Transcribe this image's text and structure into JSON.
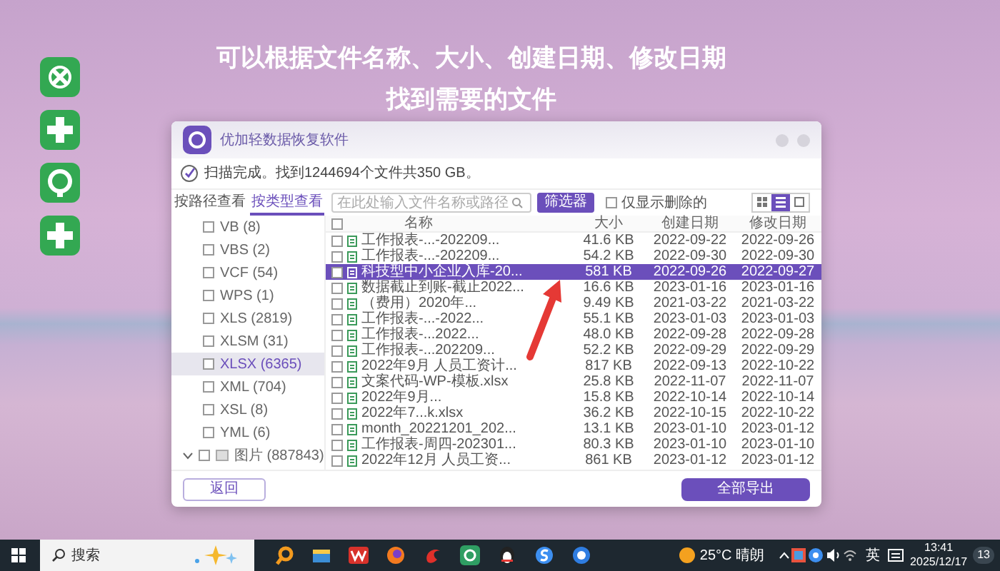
{
  "heading": {
    "lines": [
      "可以根据文件名称、大小、创建日期、修改日期",
      "找到需要的文件"
    ]
  },
  "app": {
    "title": "优加轻数据恢复软件",
    "scan_status": "扫描完成。找到1244694个文件共350 GB。",
    "view_tabs": [
      {
        "label": "按路径查看",
        "selected": false
      },
      {
        "label": "按类型查看",
        "selected": true
      }
    ],
    "search": {
      "placeholder": "在此处输入文件名称或路径"
    },
    "filter_button": "筛选器",
    "deleted_only": {
      "label": "仅显示删除的",
      "checked": false
    },
    "view_modes": [
      {
        "kind": "grid",
        "selected": false
      },
      {
        "kind": "list",
        "selected": true
      },
      {
        "kind": "preview",
        "selected": false
      }
    ],
    "file_types": [
      {
        "kind": "type",
        "label": "VB (8)",
        "checked": false,
        "selected": false
      },
      {
        "kind": "type",
        "label": "VBS (2)",
        "checked": false,
        "selected": false
      },
      {
        "kind": "type",
        "label": "VCF (54)",
        "checked": false,
        "selected": false
      },
      {
        "kind": "type",
        "label": "WPS (1)",
        "checked": false,
        "selected": false
      },
      {
        "kind": "type",
        "label": "XLS (2819)",
        "checked": false,
        "selected": false
      },
      {
        "kind": "type",
        "label": "XLSM (31)",
        "checked": false,
        "selected": false
      },
      {
        "kind": "type",
        "label": "XLSX (6365)",
        "checked": false,
        "selected": true
      },
      {
        "kind": "type",
        "label": "XML (704)",
        "checked": false,
        "selected": false
      },
      {
        "kind": "type",
        "label": "XSL (8)",
        "checked": false,
        "selected": false
      },
      {
        "kind": "type",
        "label": "YML (6)",
        "checked": false,
        "selected": false
      },
      {
        "kind": "group",
        "label": "图片 (887843)",
        "checked": false,
        "selected": false,
        "expanded": true
      }
    ],
    "table": {
      "columns": [
        "名称",
        "大小",
        "创建日期",
        "修改日期"
      ],
      "select_all": false,
      "rows": [
        {
          "name": "工作报表-...-202209...",
          "size": "41.6 KB",
          "created": "2022-09-22",
          "modified": "2022-09-26",
          "checked": false,
          "selected": false
        },
        {
          "name": "工作报表-...-202209...",
          "size": "54.2 KB",
          "created": "2022-09-30",
          "modified": "2022-09-30",
          "checked": false,
          "selected": false
        },
        {
          "name": "科技型中小企业入库-20...",
          "size": "581 KB",
          "created": "2022-09-26",
          "modified": "2022-09-27",
          "checked": false,
          "selected": true
        },
        {
          "name": "数据截止到账-截止2022...",
          "size": "16.6 KB",
          "created": "2023-01-16",
          "modified": "2023-01-16",
          "checked": false,
          "selected": false
        },
        {
          "name": "（费用）2020年...",
          "size": "9.49 KB",
          "created": "2021-03-22",
          "modified": "2021-03-22",
          "checked": false,
          "selected": false
        },
        {
          "name": "工作报表-...-2022...",
          "size": "55.1 KB",
          "created": "2023-01-03",
          "modified": "2023-01-03",
          "checked": false,
          "selected": false
        },
        {
          "name": "工作报表-...2022...",
          "size": "48.0 KB",
          "created": "2022-09-28",
          "modified": "2022-09-28",
          "checked": false,
          "selected": false
        },
        {
          "name": "工作报表-...202209...",
          "size": "52.2 KB",
          "created": "2022-09-29",
          "modified": "2022-09-29",
          "checked": false,
          "selected": false
        },
        {
          "name": "2022年9月 人员工资计...",
          "size": "817 KB",
          "created": "2022-09-13",
          "modified": "2022-10-22",
          "checked": false,
          "selected": false
        },
        {
          "name": "文案代码-WP-模板.xlsx",
          "size": "25.8 KB",
          "created": "2022-11-07",
          "modified": "2022-11-07",
          "checked": false,
          "selected": false
        },
        {
          "name": "2022年9月...",
          "size": "15.8 KB",
          "created": "2022-10-14",
          "modified": "2022-10-14",
          "checked": false,
          "selected": false
        },
        {
          "name": "2022年7...k.xlsx",
          "size": "36.2 KB",
          "created": "2022-10-15",
          "modified": "2022-10-22",
          "checked": false,
          "selected": false
        },
        {
          "name": "month_20221201_202...",
          "size": "13.1 KB",
          "created": "2023-01-10",
          "modified": "2023-01-12",
          "checked": false,
          "selected": false
        },
        {
          "name": "工作报表-周四-202301...",
          "size": "80.3 KB",
          "created": "2023-01-10",
          "modified": "2023-01-10",
          "checked": false,
          "selected": false
        },
        {
          "name": "2022年12月 人员工资...",
          "size": "861 KB",
          "created": "2023-01-12",
          "modified": "2023-01-12",
          "checked": false,
          "selected": false
        }
      ]
    },
    "buttons": {
      "back": "返回",
      "export": "全部导出"
    }
  },
  "taskbar": {
    "search": {
      "placeholder": "搜索"
    },
    "weather": "25°C 晴朗",
    "input_method": "英",
    "time": "13:41",
    "date": "2025/12/17",
    "notifications": "13"
  }
}
